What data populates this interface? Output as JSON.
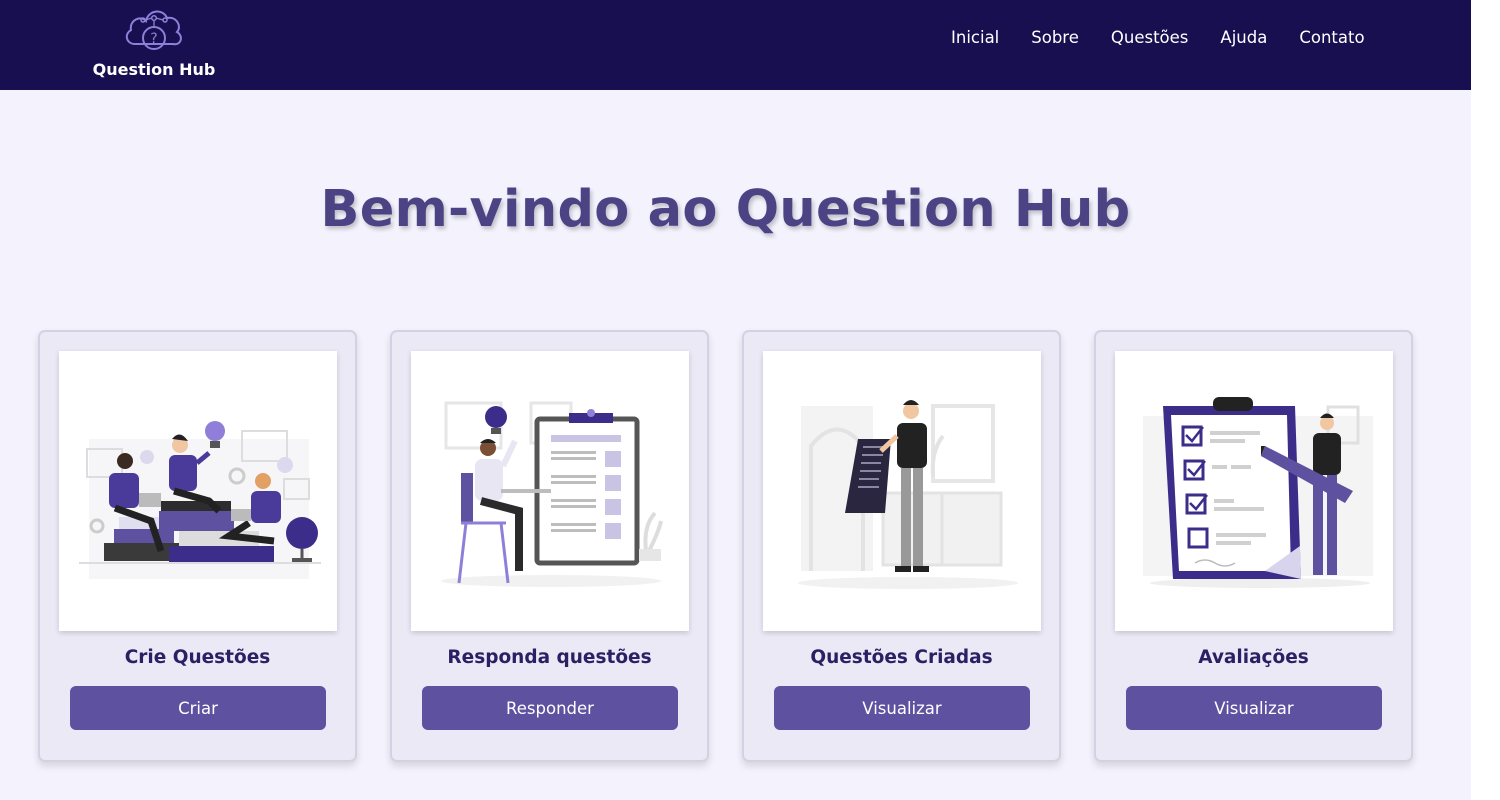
{
  "header": {
    "logo_text": "Question Hub",
    "nav": [
      "Inicial",
      "Sobre",
      "Questões",
      "Ajuda",
      "Contato"
    ]
  },
  "main": {
    "title": "Bem-vindo ao Question Hub",
    "cards": [
      {
        "title": "Crie Questões",
        "button": "Criar",
        "illustration": "people-studying-illustration"
      },
      {
        "title": "Responda questões",
        "button": "Responder",
        "illustration": "student-answering-quiz-illustration"
      },
      {
        "title": "Questões Criadas",
        "button": "Visualizar",
        "illustration": "man-reading-list-illustration"
      },
      {
        "title": "Avaliações",
        "button": "Visualizar",
        "illustration": "checklist-clipboard-illustration"
      }
    ]
  },
  "colors": {
    "header_bg": "#180f50",
    "page_bg": "#f4f3fd",
    "title": "#4c4384",
    "card_bg": "#ebe9f6",
    "card_title": "#2a2063",
    "button_bg": "#5e52a0"
  }
}
